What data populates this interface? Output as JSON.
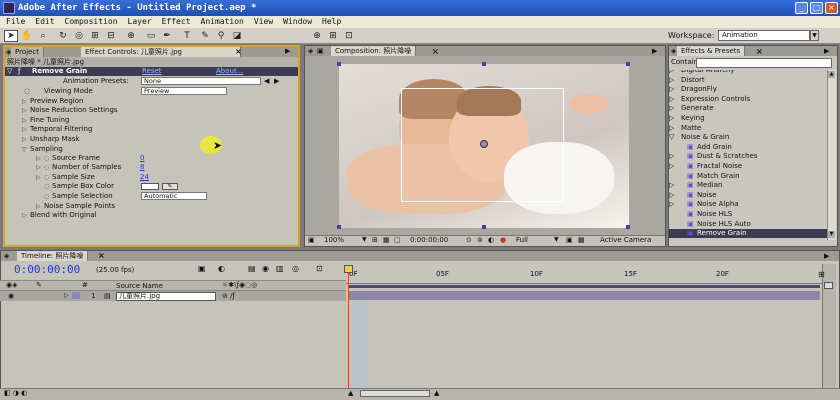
{
  "window": {
    "title": "Adobe After Effects - Untitled Project.aep *"
  },
  "menu": [
    "File",
    "Edit",
    "Composition",
    "Layer",
    "Effect",
    "Animation",
    "View",
    "Window",
    "Help"
  ],
  "workspace": {
    "label": "Workspace:",
    "value": "Animation"
  },
  "project_panel": {
    "tabs": [
      "Project",
      "Effect Controls: 儿童照片.jpg"
    ],
    "breadcrumb": "照片降噪 * 儿童照片.jpg",
    "effect_name": "Remove Grain",
    "reset": "Reset",
    "about": "About...",
    "presets_label": "Animation Presets:",
    "presets_value": "None",
    "viewing_mode_label": "Viewing Mode",
    "viewing_mode_value": "Preview",
    "groups": [
      "Preview Region",
      "Noise Reduction Settings",
      "Fine Tuning",
      "Temporal Filtering",
      "Unsharp Mask"
    ],
    "sampling": "Sampling",
    "sampling_props": [
      {
        "label": "Source Frame",
        "value": "0"
      },
      {
        "label": "Number of Samples",
        "value": "8"
      },
      {
        "label": "Sample Size",
        "value": "24"
      }
    ],
    "sample_box_color": "Sample Box Color",
    "sample_selection_label": "Sample Selection",
    "sample_selection_value": "Automatic",
    "noise_sample_points": "Noise Sample Points",
    "blend": "Blend with Original"
  },
  "composition_panel": {
    "tab": "Composition: 照片降噪",
    "zoom": "100%",
    "timecode": "0:00:00:00",
    "resolution": "Full",
    "camera": "Active Camera"
  },
  "effects_panel": {
    "tab": "Effects & Presets",
    "contains_label": "Contains:",
    "items": [
      {
        "label": "Digital Anarchy",
        "level": 0
      },
      {
        "label": "Distort",
        "level": 0
      },
      {
        "label": "DragonFly",
        "level": 0
      },
      {
        "label": "Expression Controls",
        "level": 0
      },
      {
        "label": "Generate",
        "level": 0
      },
      {
        "label": "Keying",
        "level": 0
      },
      {
        "label": "Matte",
        "level": 0
      },
      {
        "label": "Noise & Grain",
        "level": 0,
        "open": true
      },
      {
        "label": "Add Grain",
        "level": 1
      },
      {
        "label": "Dust & Scratches",
        "level": 1,
        "arrow": true
      },
      {
        "label": "Fractal Noise",
        "level": 1,
        "arrow": true
      },
      {
        "label": "Match Grain",
        "level": 1
      },
      {
        "label": "Median",
        "level": 1,
        "arrow": true
      },
      {
        "label": "Noise",
        "level": 1,
        "arrow": true
      },
      {
        "label": "Noise Alpha",
        "level": 1,
        "arrow": true
      },
      {
        "label": "Noise HLS",
        "level": 1
      },
      {
        "label": "Noise HLS Auto",
        "level": 1
      },
      {
        "label": "Remove Grain",
        "level": 1,
        "selected": true
      }
    ]
  },
  "timeline_panel": {
    "tab": "Timeline: 照片降噪",
    "timecode": "0:00:00:00",
    "fps": "(25.00 fps)",
    "column_source": "Source Name",
    "layer_index": "1",
    "layer_name": "儿童照片.jpg",
    "ruler": [
      "0F",
      "05F",
      "10F",
      "15F",
      "20F"
    ]
  },
  "colors": {
    "accent": "#1f3ec8",
    "selection": "#3b3b52",
    "titlebar": "#1d4fb8",
    "track": "#8d86a8"
  }
}
